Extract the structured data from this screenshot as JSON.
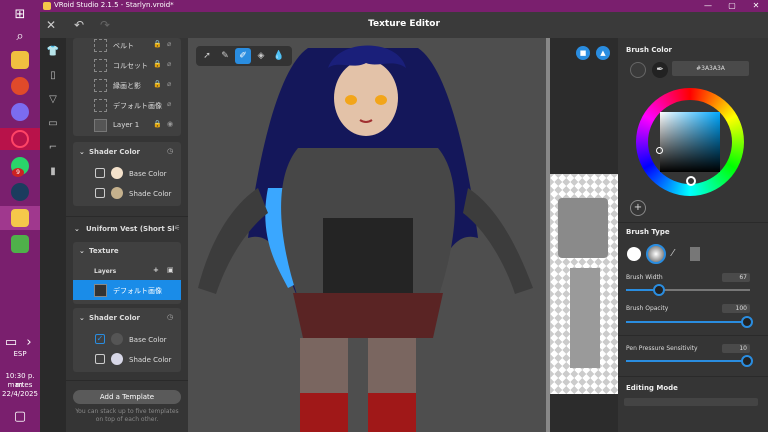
{
  "window": {
    "title": "VRoid Studio 2.1.5 - Starlyn.vroid*"
  },
  "header": {
    "title": "Texture Editor"
  },
  "taskbar": {
    "lang": "ESP",
    "time": "10:30 p. m.",
    "day": "martes",
    "date": "22/4/2025",
    "badge": "9"
  },
  "left_panel": {
    "layers": [
      {
        "label": "ベルト"
      },
      {
        "label": "コルセット"
      },
      {
        "label": "縁画と影"
      },
      {
        "label": "デフォルト画像"
      },
      {
        "label": "Layer 1"
      }
    ],
    "shader1": {
      "title": "Shader Color",
      "base": "Base Color",
      "shade": "Shade Color"
    },
    "item_title": "Uniform Vest (Short Sl",
    "texture_title": "Texture",
    "layers_title": "Layers",
    "selected_layer": "デフォルト画像",
    "shader2": {
      "title": "Shader Color",
      "base": "Base Color",
      "shade": "Shade Color"
    },
    "add_template": "Add a Template",
    "note": "You can stack up to five templates on top of each other."
  },
  "right_panel": {
    "brush_color_title": "Brush Color",
    "hex": "#3A3A3A",
    "brush_type_title": "Brush Type",
    "width_label": "Brush Width",
    "width_value": "67",
    "opacity_label": "Brush Opacity",
    "opacity_value": "100",
    "pressure_label": "Pen Pressure Sensitivity",
    "pressure_value": "10",
    "editing_mode_title": "Editing Mode"
  },
  "colors": {
    "accent": "#2a8de0",
    "taskbar": "#7a1f6e",
    "brush": "#3A3A3A"
  }
}
